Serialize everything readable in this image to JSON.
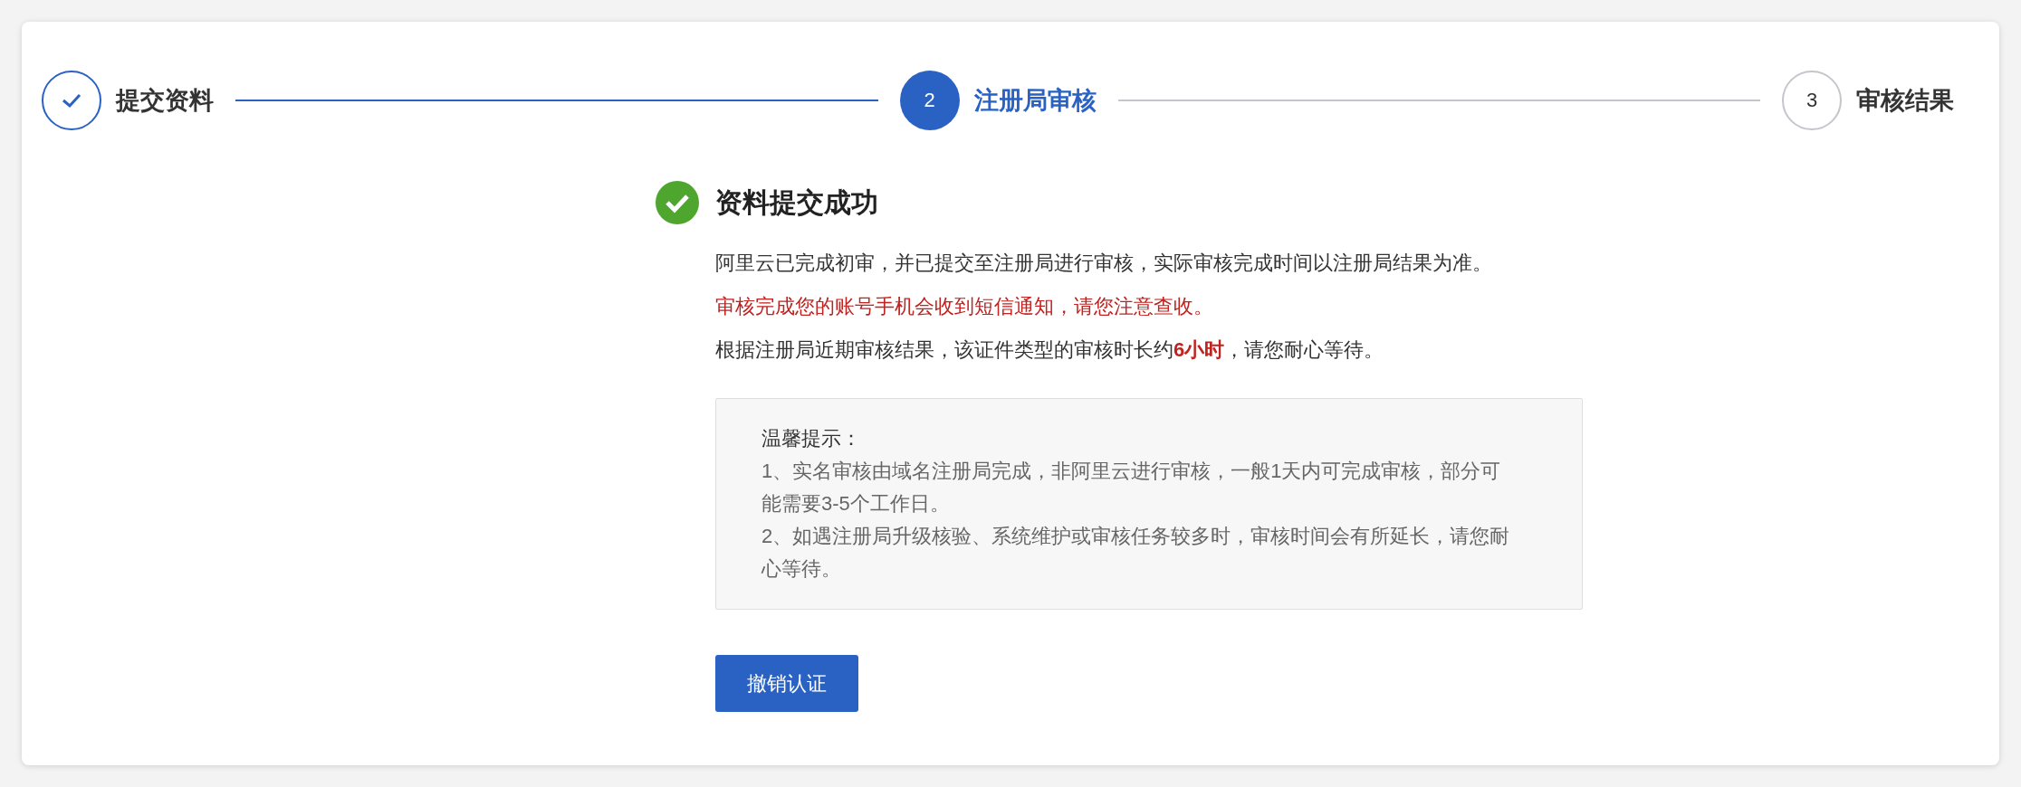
{
  "steps": [
    {
      "label": "提交资料",
      "done": true,
      "selected": false
    },
    {
      "number": "2",
      "label": "注册局审核",
      "done": false,
      "selected": true
    },
    {
      "number": "3",
      "label": "审核结果",
      "done": false,
      "selected": false
    }
  ],
  "result": {
    "title": "资料提交成功",
    "lines": [
      {
        "text": "阿里云已完成初审，并已提交至注册局进行审核，实际审核完成时间以注册局结果为准。",
        "kind": "normal"
      },
      {
        "text": "审核完成您的账号手机会收到短信通知，请您注意查收。",
        "kind": "warning"
      },
      {
        "text": "根据注册局近期审核结果，该证件类型的审核时长约**6小时**，请您耐心等待。",
        "kind": "normal"
      }
    ]
  },
  "tips": {
    "title": "温馨提示：",
    "items": [
      "1、实名审核由域名注册局完成，非阿里云进行审核，一般1天内可完成审核，部分可能需要3-5个工作日。",
      "2、如遇注册局升级核验、系统维护或审核任务较多时，审核时间会有所延长，请您耐心等待。"
    ]
  },
  "button": "撤销认证"
}
